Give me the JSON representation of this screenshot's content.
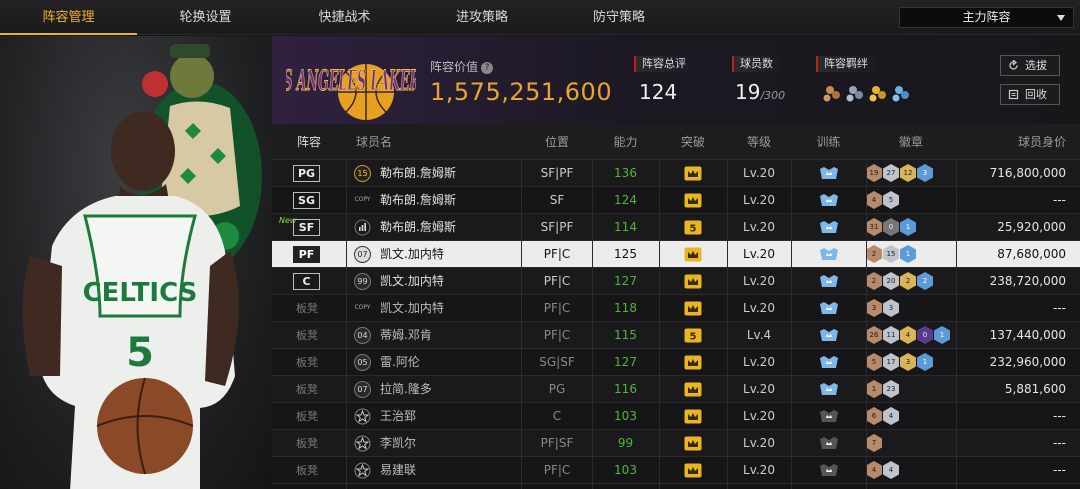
{
  "tabs": [
    {
      "label": "阵容管理",
      "active": true
    },
    {
      "label": "轮换设置",
      "active": false
    },
    {
      "label": "快捷战术",
      "active": false
    },
    {
      "label": "进攻策略",
      "active": false
    },
    {
      "label": "防守策略",
      "active": false
    }
  ],
  "lineup_select": {
    "value": "主力阵容"
  },
  "header": {
    "team_logo_text": "LOS ANGELES LAKERS",
    "value_label": "阵容价值",
    "value_help_icon": "?",
    "value": "1,575,251,600",
    "rating_label": "阵容总评",
    "rating": "124",
    "count_label": "球员数",
    "count": "19",
    "count_max": "/300",
    "chem_label": "阵容羁绊",
    "select_btn": "选拔",
    "recycle_btn": "回收"
  },
  "colors": {
    "accent": "#f0b02c",
    "value_gold": "#e8a530",
    "green_stat": "#4fb63a",
    "new_tag": "#8fdc3a"
  },
  "columns": [
    "阵容",
    "球员名",
    "位置",
    "能力",
    "突破",
    "等级",
    "训练",
    "徽章",
    "球员身价"
  ],
  "rows": [
    {
      "slot": "PG",
      "is_bench": false,
      "is_new": false,
      "card": "15",
      "card_type": "gold",
      "name": "勒布朗.詹姆斯",
      "position": "SF|PF",
      "ability": "136",
      "ability_green": true,
      "breakthrough": "crown",
      "level": "Lv.20",
      "training": "blue",
      "badges": [
        [
          "19",
          "bronze"
        ],
        [
          "27",
          "silver"
        ],
        [
          "12",
          "gold"
        ],
        [
          "3",
          "blue"
        ]
      ],
      "price": "716,800,000",
      "selected": false
    },
    {
      "slot": "SG",
      "is_bench": false,
      "is_new": false,
      "card": "COPY",
      "card_type": "copy",
      "name": "勒布朗.詹姆斯",
      "position": "SF",
      "ability": "124",
      "ability_green": true,
      "breakthrough": "crown",
      "level": "Lv.20",
      "training": "blue",
      "badges": [
        [
          "4",
          "bronze"
        ],
        [
          "5",
          "silver"
        ]
      ],
      "price": "---",
      "selected": false
    },
    {
      "slot": "SF",
      "is_bench": false,
      "is_new": true,
      "new_text": "New",
      "card": "bars",
      "card_type": "bars",
      "name": "勒布朗.詹姆斯",
      "position": "SF|PF",
      "ability": "114",
      "ability_green": true,
      "breakthrough": "5",
      "level": "Lv.20",
      "training": "blue",
      "badges": [
        [
          "31",
          "bronze"
        ],
        [
          "0",
          "dark"
        ],
        [
          "1",
          "blue"
        ]
      ],
      "price": "25,920,000",
      "selected": false
    },
    {
      "slot": "PF",
      "is_bench": false,
      "is_new": false,
      "card": "07",
      "card_type": "num",
      "name": "凯文.加内特",
      "position": "PF|C",
      "ability": "125",
      "ability_green": false,
      "breakthrough": "crown",
      "level": "Lv.20",
      "training": "blue",
      "badges": [
        [
          "2",
          "bronze"
        ],
        [
          "15",
          "silver"
        ],
        [
          "1",
          "blue"
        ]
      ],
      "price": "87,680,000",
      "selected": true
    },
    {
      "slot": "C",
      "is_bench": false,
      "is_new": false,
      "card": "99",
      "card_type": "plain",
      "name": "凯文.加内特",
      "position": "PF|C",
      "ability": "127",
      "ability_green": true,
      "breakthrough": "crown",
      "level": "Lv.20",
      "training": "blue",
      "badges": [
        [
          "2",
          "bronze"
        ],
        [
          "20",
          "silver"
        ],
        [
          "2",
          "gold"
        ],
        [
          "2",
          "blue"
        ]
      ],
      "price": "238,720,000",
      "selected": false
    },
    {
      "slot": "板凳",
      "is_bench": true,
      "is_new": false,
      "card": "COPY",
      "card_type": "copy",
      "name": "凯文.加内特",
      "position": "PF|C",
      "ability": "118",
      "ability_green": true,
      "breakthrough": "crown",
      "level": "Lv.20",
      "training": "blue",
      "badges": [
        [
          "3",
          "bronze"
        ],
        [
          "3",
          "silver"
        ]
      ],
      "price": "---",
      "selected": false
    },
    {
      "slot": "板凳",
      "is_bench": true,
      "is_new": false,
      "card": "04",
      "card_type": "plain",
      "name": "蒂姆.邓肯",
      "position": "PF|C",
      "ability": "115",
      "ability_green": true,
      "breakthrough": "5",
      "level": "Lv.4",
      "training": "blue",
      "badges": [
        [
          "26",
          "bronze"
        ],
        [
          "11",
          "silver"
        ],
        [
          "4",
          "gold"
        ],
        [
          "0",
          "purple"
        ],
        [
          "1",
          "blue"
        ]
      ],
      "price": "137,440,000",
      "selected": false
    },
    {
      "slot": "板凳",
      "is_bench": true,
      "is_new": false,
      "card": "05",
      "card_type": "plain",
      "name": "雷.阿伦",
      "position": "SG|SF",
      "ability": "127",
      "ability_green": true,
      "breakthrough": "crown",
      "level": "Lv.20",
      "training": "blue",
      "badges": [
        [
          "5",
          "bronze"
        ],
        [
          "17",
          "silver"
        ],
        [
          "3",
          "gold"
        ],
        [
          "1",
          "blue"
        ]
      ],
      "price": "232,960,000",
      "selected": false
    },
    {
      "slot": "板凳",
      "is_bench": true,
      "is_new": false,
      "card": "07",
      "card_type": "plain",
      "name": "拉简.隆多",
      "position": "PG",
      "ability": "116",
      "ability_green": true,
      "breakthrough": "crown",
      "level": "Lv.20",
      "training": "blue",
      "badges": [
        [
          "1",
          "bronze"
        ],
        [
          "23",
          "silver"
        ]
      ],
      "price": "5,881,600",
      "selected": false
    },
    {
      "slot": "板凳",
      "is_bench": true,
      "is_new": false,
      "card": "star",
      "card_type": "star",
      "name": "王治郅",
      "position": "C",
      "ability": "103",
      "ability_green": true,
      "breakthrough": "crown",
      "level": "Lv.20",
      "training": "gray",
      "badges": [
        [
          "6",
          "bronze"
        ],
        [
          "4",
          "silver"
        ]
      ],
      "price": "---",
      "selected": false
    },
    {
      "slot": "板凳",
      "is_bench": true,
      "is_new": false,
      "card": "star",
      "card_type": "star",
      "name": "李凯尔",
      "position": "PF|SF",
      "ability": "99",
      "ability_green": true,
      "breakthrough": "crown",
      "level": "Lv.20",
      "training": "gray",
      "badges": [
        [
          "7",
          "bronze"
        ]
      ],
      "price": "---",
      "selected": false
    },
    {
      "slot": "板凳",
      "is_bench": true,
      "is_new": false,
      "card": "star",
      "card_type": "star",
      "name": "易建联",
      "position": "PF|C",
      "ability": "103",
      "ability_green": true,
      "breakthrough": "crown",
      "level": "Lv.20",
      "training": "gray",
      "badges": [
        [
          "4",
          "bronze"
        ],
        [
          "4",
          "silver"
        ]
      ],
      "price": "---",
      "selected": false
    }
  ]
}
